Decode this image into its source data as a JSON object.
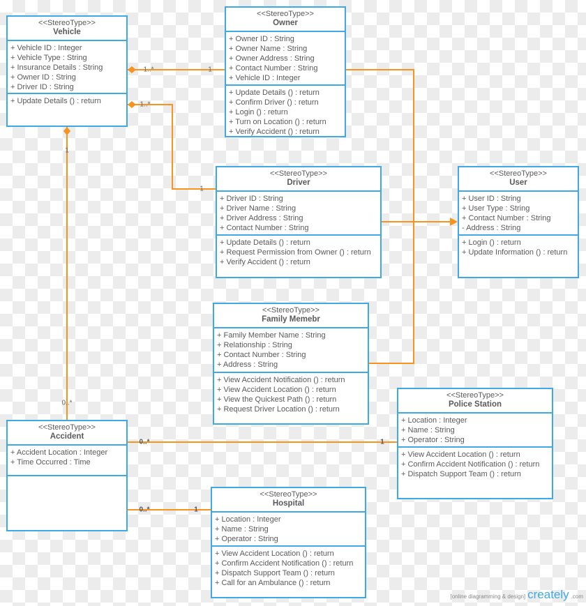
{
  "colors": {
    "class_border": "#3fa9e5",
    "connector": "#f7931e",
    "text": "#5a5a5a"
  },
  "classes": [
    {
      "id": "vehicle",
      "stereotype": "<<StereoType>>",
      "name": "Vehicle",
      "attributes": [
        "+ Vehicle ID : Integer",
        "+ Vehicle Type : String",
        "+ Insurance Details : String",
        "+ Owner ID : String",
        "+ Driver ID : String"
      ],
      "operations": [
        "+ Update Details () : return"
      ]
    },
    {
      "id": "owner",
      "stereotype": "<<StereoType>>",
      "name": "Owner",
      "attributes": [
        "+ Owner ID : String",
        "+ Owner Name : String",
        "+ Owner Address : String",
        "+ Contact Number : String",
        "+ Vehicle ID : Integer"
      ],
      "operations": [
        "+ Update Details () : return",
        "+ Confirm Driver () : return",
        "+ Login () : return",
        "+ Turn on Location () : return",
        "+ Verify Accident () : return"
      ]
    },
    {
      "id": "driver",
      "stereotype": "<<StereoType>>",
      "name": "Driver",
      "attributes": [
        "+ Driver ID : String",
        "+ Driver Name : String",
        "+ Driver Address : String",
        "+ Contact Number : String"
      ],
      "operations": [
        "+ Update Details () : return",
        "+ Request Permission from Owner () : return",
        "+ Verify Accident () : return"
      ]
    },
    {
      "id": "user",
      "stereotype": "<<StereoType>>",
      "name": "User",
      "attributes": [
        "+ User ID : String",
        "+ User Type : String",
        "+ Contact Number : String",
        "- Address : String"
      ],
      "operations": [
        "+ Login () : return",
        "+ Update Information () : return"
      ]
    },
    {
      "id": "family",
      "stereotype": "<<StereoType>>",
      "name": "Family Memebr",
      "attributes": [
        "+ Family Member Name : String",
        "+ Relationship : String",
        "+ Contact Number : String",
        "+ Address : String"
      ],
      "operations": [
        "+ View Accident Notification () : return",
        "+ View Accident Location () : return",
        "+ View the Quickest Path () : return",
        "+ Request Driver Location () : return"
      ]
    },
    {
      "id": "police",
      "stereotype": "<<StereoType>>",
      "name": "Police Station",
      "attributes": [
        "+ Location : Integer",
        "+ Name : String",
        "+ Operator : String"
      ],
      "operations": [
        "+ View Accident Location () : return",
        "+ Confirm Accident Notification () : return",
        "+ Dispatch Support Team () : return"
      ]
    },
    {
      "id": "accident",
      "stereotype": "<<StereoType>>",
      "name": "Accident",
      "attributes": [
        "+ Accident Location : Integer",
        "+ Time Occurred : Time"
      ],
      "operations": []
    },
    {
      "id": "hospital",
      "stereotype": "<<StereoType>>",
      "name": "Hospital",
      "attributes": [
        "+ Location : Integer",
        "+ Name : String",
        "+ Operator : String"
      ],
      "operations": [
        "+ View Accident Location () : return",
        "+ Confirm Accident Notification () : return",
        "+ Dispatch Support Team () : return",
        "+ Call for an Ambulance () : return"
      ]
    }
  ],
  "relations": [
    {
      "id": "vehicle-owner",
      "type": "composition",
      "from": "vehicle",
      "to": "owner",
      "from_mult": "1..*",
      "to_mult": "1"
    },
    {
      "id": "vehicle-driver",
      "type": "composition",
      "from": "vehicle",
      "to": "driver",
      "from_mult": "1..*",
      "to_mult": "1"
    },
    {
      "id": "vehicle-accident",
      "type": "composition",
      "from": "vehicle",
      "to": "accident",
      "from_mult": "1",
      "to_mult": "0..*"
    },
    {
      "id": "owner-user",
      "type": "generalization",
      "from": "owner",
      "to": "user"
    },
    {
      "id": "driver-user",
      "type": "generalization",
      "from": "driver",
      "to": "user"
    },
    {
      "id": "family-user",
      "type": "generalization",
      "from": "family",
      "to": "user"
    },
    {
      "id": "accident-police",
      "type": "association",
      "from": "accident",
      "to": "police",
      "from_mult": "0..*",
      "to_mult": "1"
    },
    {
      "id": "accident-hospital",
      "type": "association",
      "from": "accident",
      "to": "hospital",
      "from_mult": "0..*",
      "to_mult": "1"
    }
  ],
  "branding": {
    "tagline": "[online diagramming & design]",
    "logo": "creately",
    "suffix": ".com"
  }
}
